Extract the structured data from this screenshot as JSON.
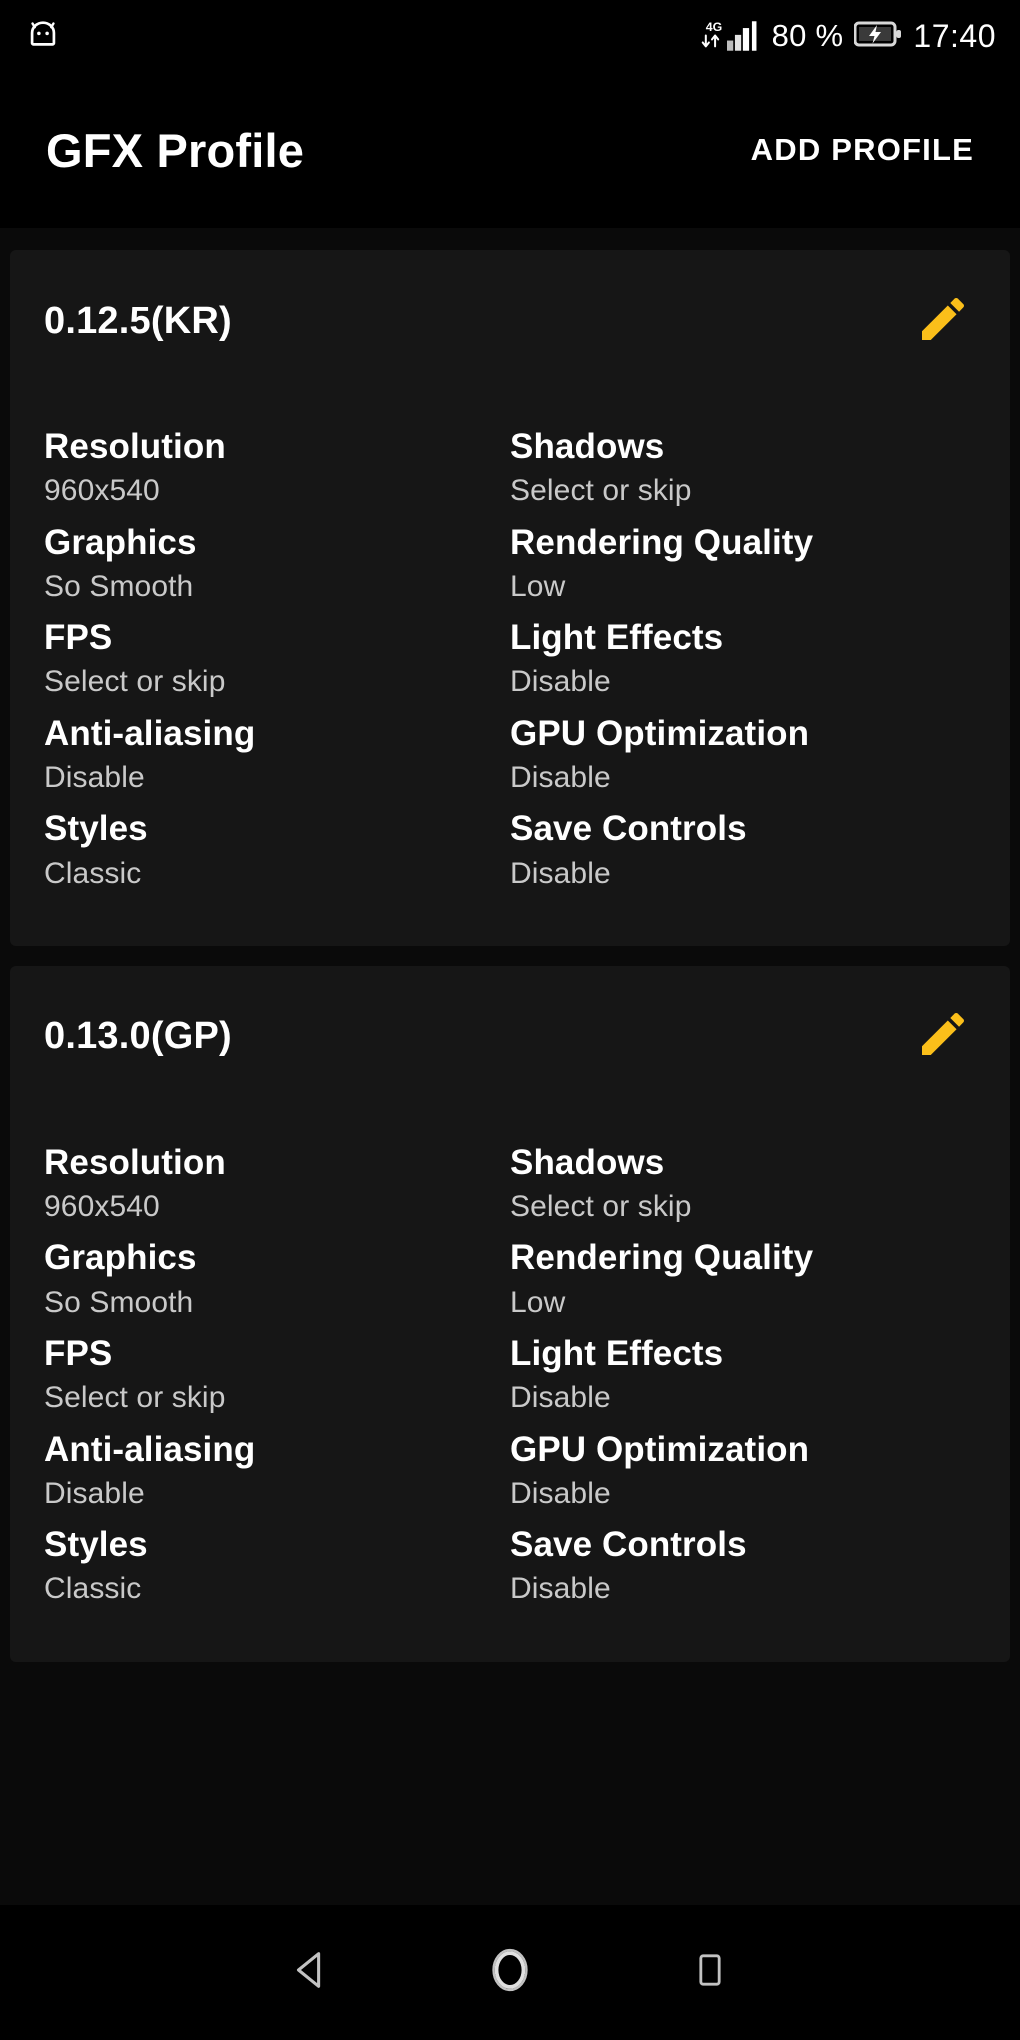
{
  "status_bar": {
    "left_icon": "android-robot-icon",
    "network_type": "4G",
    "signal_icon": "signal-bars-icon",
    "data_arrows_icon": "data-transfer-icon",
    "battery_percent": "80 %",
    "battery_icon": "battery-charging-icon",
    "time": "17:40"
  },
  "app_bar": {
    "title": "GFX Profile",
    "add_profile_label": "ADD PROFILE"
  },
  "profiles": [
    {
      "title": "0.12.5(KR)",
      "edit_icon": "pencil-edit-icon",
      "left_column": [
        {
          "label": "Resolution",
          "value": "960x540"
        },
        {
          "label": "Graphics",
          "value": "So Smooth"
        },
        {
          "label": "FPS",
          "value": "Select or skip"
        },
        {
          "label": "Anti-aliasing",
          "value": "Disable"
        },
        {
          "label": "Styles",
          "value": "Classic"
        }
      ],
      "right_column": [
        {
          "label": "Shadows",
          "value": "Select or skip"
        },
        {
          "label": "Rendering Quality",
          "value": "Low"
        },
        {
          "label": "Light Effects",
          "value": "Disable"
        },
        {
          "label": "GPU Optimization",
          "value": "Disable"
        },
        {
          "label": "Save Controls",
          "value": "Disable"
        }
      ]
    },
    {
      "title": "0.13.0(GP)",
      "edit_icon": "pencil-edit-icon",
      "left_column": [
        {
          "label": "Resolution",
          "value": "960x540"
        },
        {
          "label": "Graphics",
          "value": "So Smooth"
        },
        {
          "label": "FPS",
          "value": "Select or skip"
        },
        {
          "label": "Anti-aliasing",
          "value": "Disable"
        },
        {
          "label": "Styles",
          "value": "Classic"
        }
      ],
      "right_column": [
        {
          "label": "Shadows",
          "value": "Select or skip"
        },
        {
          "label": "Rendering Quality",
          "value": "Low"
        },
        {
          "label": "Light Effects",
          "value": "Disable"
        },
        {
          "label": "GPU Optimization",
          "value": "Disable"
        },
        {
          "label": "Save Controls",
          "value": "Disable"
        }
      ]
    }
  ],
  "nav_bar": {
    "back_icon": "back-triangle-icon",
    "home_icon": "home-circle-icon",
    "recents_icon": "recents-square-icon"
  },
  "colors": {
    "page_background": "#0a0a0a",
    "card_background": "#161616",
    "accent": "#fbbf1a",
    "label_text": "#ffffff",
    "value_text": "#c9c9c9",
    "bar_background": "#000000"
  }
}
